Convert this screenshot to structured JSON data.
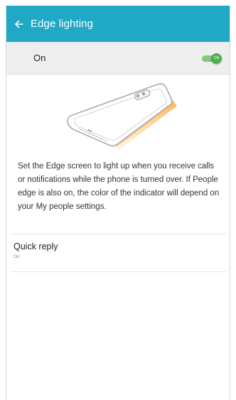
{
  "app_bar": {
    "title": "Edge lighting",
    "background": "#1fa9c4",
    "back_icon": "arrow-left-icon"
  },
  "master_switch": {
    "label": "On",
    "state": true,
    "toggle_text": "ON",
    "accent": "#4caf50"
  },
  "illustration": {
    "subject": "phone with lit edge",
    "glow_color": "#ffb347"
  },
  "description": "Set the Edge screen to light up when you receive calls or notifications while the phone is turned over. If People edge is also on, the color of the indicator will depend on your My people settings.",
  "items": [
    {
      "title": "Quick reply",
      "subtitle": "On"
    }
  ]
}
